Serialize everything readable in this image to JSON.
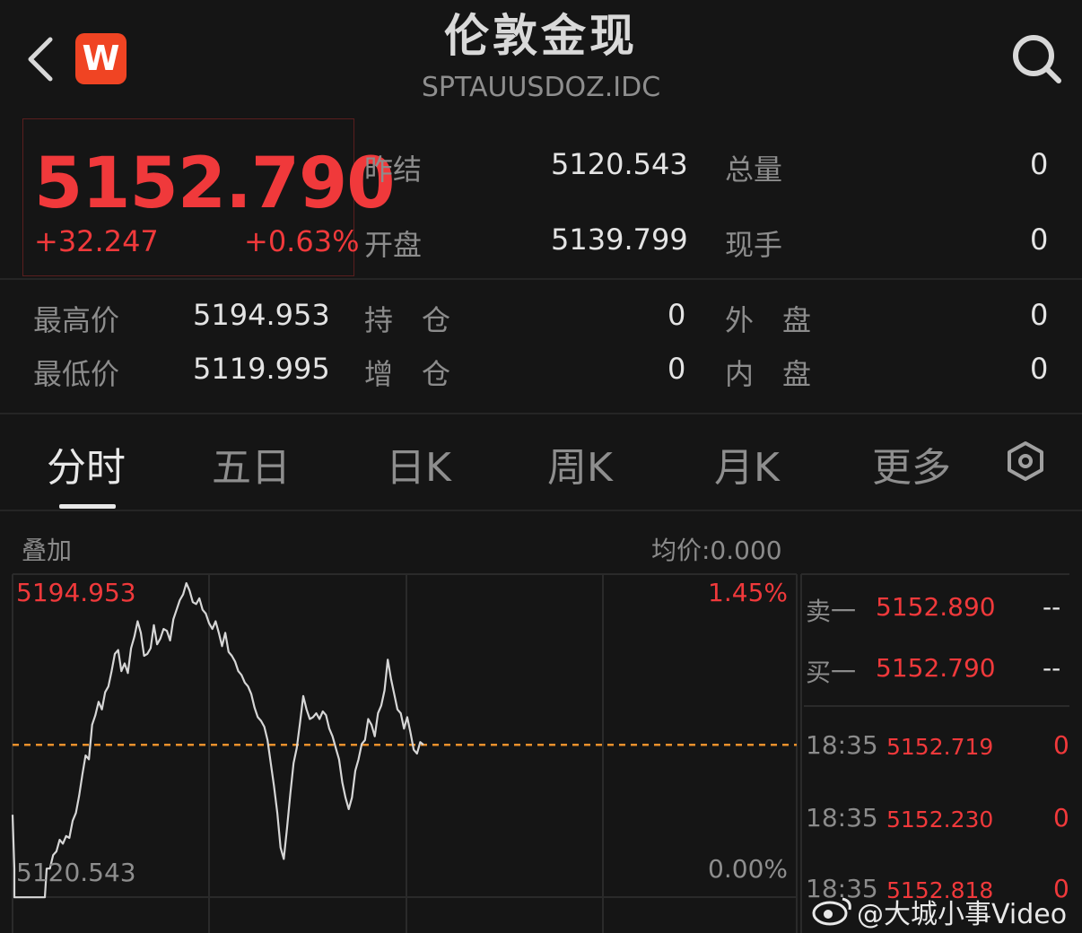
{
  "header": {
    "title": "伦敦金现",
    "code": "SPTAUUSDOZ.IDC",
    "logo_text": "W",
    "back_icon": "chevron-left-icon",
    "search_icon": "search-icon"
  },
  "quote": {
    "price": "5152.790",
    "change": "+32.247",
    "change_pct": "+0.63%",
    "rows": [
      {
        "l1": "昨结",
        "v1": "5120.543",
        "l2": "总量",
        "v2": "0"
      },
      {
        "l1": "开盘",
        "v1": "5139.799",
        "l2": "现手",
        "v2": "0"
      }
    ],
    "stats": [
      {
        "l1": "最高价",
        "v1": "5194.953",
        "l2": "持　仓",
        "v2": "0",
        "l3": "外　盘",
        "v3": "0"
      },
      {
        "l1": "最低价",
        "v1": "5119.995",
        "l2": "增　仓",
        "v2": "0",
        "l3": "内　盘",
        "v3": "0"
      }
    ]
  },
  "tabs": [
    "分时",
    "五日",
    "日K",
    "周K",
    "月K",
    "更多"
  ],
  "settings_icon": "hexagon-settings-icon",
  "chart_bar": {
    "overlay": "叠加",
    "avg": "均价:0.000"
  },
  "chart_data": {
    "type": "line",
    "ylim": [
      5120.543,
      5194.953
    ],
    "y_top_label": "5194.953",
    "y_bottom_label": "5120.543",
    "pct_top": "1.45%",
    "pct_bottom": "0.00%",
    "baseline": 5120.543,
    "series": [
      {
        "values": [
          5120.5,
          5120.5,
          5124.0,
          5125.0,
          5128.0,
          5127.0,
          5129.0,
          5128.5,
          5133.0,
          5135.0,
          5139.5,
          5145.0,
          5150.0,
          5149.0,
          5158.0,
          5160.5,
          5164.0,
          5162.0,
          5166.5,
          5168.0,
          5172.0,
          5176.5,
          5177.5,
          5172.0,
          5174.0,
          5171.5,
          5178.0,
          5181.0,
          5185.0,
          5182.0,
          5176.0,
          5176.5,
          5178.0,
          5184.0,
          5179.0,
          5180.5,
          5183.0,
          5182.5,
          5180.0,
          5185.5,
          5188.0,
          5190.5,
          5192.0,
          5194.95,
          5193.0,
          5190.0,
          5189.5,
          5191.0,
          5188.0,
          5187.0,
          5184.5,
          5183.0,
          5185.0,
          5182.0,
          5178.5,
          5182.0,
          5177.0,
          5176.0,
          5174.5,
          5172.0,
          5171.0,
          5169.0,
          5168.0,
          5166.0,
          5162.5,
          5160.0,
          5159.0,
          5157.5,
          5154.0,
          5148.0,
          5142.0,
          5135.0,
          5126.0,
          5123.0,
          5131.0,
          5140.0,
          5148.0,
          5152.0,
          5158.5,
          5165.5,
          5162.0,
          5159.5,
          5160.0,
          5161.0,
          5159.5,
          5161.5,
          5160.5,
          5157.0,
          5155.0,
          5152.0,
          5149.0,
          5143.0,
          5139.0,
          5136.0,
          5139.0,
          5146.0,
          5149.0,
          5153.0,
          5154.0,
          5159.5,
          5158.0,
          5155.0,
          5161.0,
          5163.0,
          5167.0,
          5175.0,
          5170.0,
          5166.0,
          5162.0,
          5161.0,
          5157.0,
          5160.0,
          5156.0,
          5151.5,
          5150.5,
          5153.5,
          5152.8
        ]
      }
    ],
    "order_book": [
      {
        "label": "卖一",
        "price": "5152.890",
        "vol": "--"
      },
      {
        "label": "买一",
        "price": "5152.790",
        "vol": "--"
      }
    ],
    "ticks": [
      {
        "time": "18:35",
        "price": "5152.719",
        "vol": "0"
      },
      {
        "time": "18:35",
        "price": "5152.230",
        "vol": "0"
      },
      {
        "time": "18:35",
        "price": "5152.818",
        "vol": "0"
      }
    ]
  },
  "watermark": "@大城小事Video"
}
